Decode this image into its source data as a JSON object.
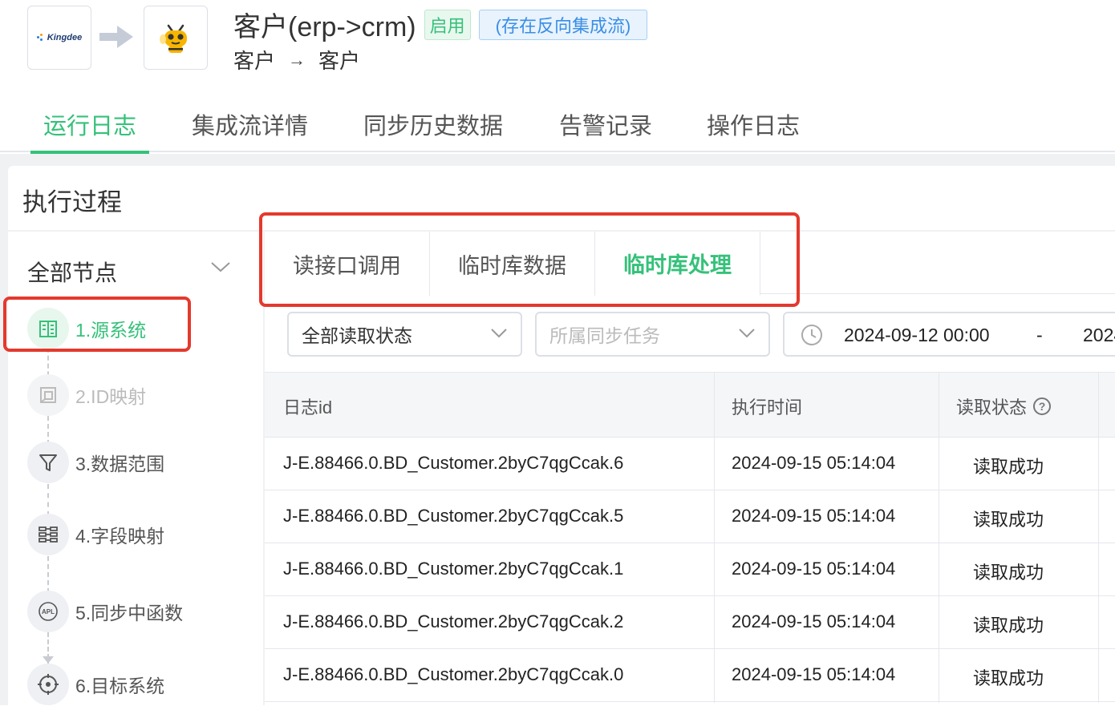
{
  "header": {
    "source_logo_text": "Kingdee",
    "title": "客户(erp->crm)",
    "status_tag": "启用",
    "reverse_tag": "(存在反向集成流)",
    "subtitle_source": "客户",
    "subtitle_arrow": "→",
    "subtitle_target": "客户"
  },
  "tabs": [
    {
      "label": "运行日志",
      "active": true
    },
    {
      "label": "集成流详情",
      "active": false
    },
    {
      "label": "同步历史数据",
      "active": false
    },
    {
      "label": "告警记录",
      "active": false
    },
    {
      "label": "操作日志",
      "active": false
    }
  ],
  "section": {
    "title": "执行过程"
  },
  "sidebar": {
    "all_nodes_label": "全部节点",
    "nodes": [
      {
        "label": "1.源系统",
        "icon": "building-icon",
        "state": "active"
      },
      {
        "label": "2.ID映射",
        "icon": "id-mapping-icon",
        "state": "disabled"
      },
      {
        "label": "3.数据范围",
        "icon": "filter-icon",
        "state": "normal"
      },
      {
        "label": "4.字段映射",
        "icon": "field-mapping-icon",
        "state": "normal"
      },
      {
        "label": "5.同步中函数",
        "icon": "apl-icon",
        "state": "normal"
      },
      {
        "label": "6.目标系统",
        "icon": "target-icon",
        "state": "normal"
      }
    ]
  },
  "subtabs": [
    {
      "label": "读接口调用",
      "active": false
    },
    {
      "label": "临时库数据",
      "active": false
    },
    {
      "label": "临时库处理",
      "active": true
    }
  ],
  "filters": {
    "read_status": "全部读取状态",
    "sync_task_placeholder": "所属同步任务",
    "date_start": "2024-09-12 00:00",
    "date_separator": "-",
    "date_end": "2024"
  },
  "table": {
    "columns": [
      "日志id",
      "执行时间",
      "读取状态"
    ],
    "rows": [
      [
        "J-E.88466.0.BD_Customer.2byC7qgCcak.6",
        "2024-09-15 05:14:04",
        "读取成功"
      ],
      [
        "J-E.88466.0.BD_Customer.2byC7qgCcak.5",
        "2024-09-15 05:14:04",
        "读取成功"
      ],
      [
        "J-E.88466.0.BD_Customer.2byC7qgCcak.1",
        "2024-09-15 05:14:04",
        "读取成功"
      ],
      [
        "J-E.88466.0.BD_Customer.2byC7qgCcak.2",
        "2024-09-15 05:14:04",
        "读取成功"
      ],
      [
        "J-E.88466.0.BD_Customer.2byC7qgCcak.0",
        "2024-09-15 05:14:04",
        "读取成功"
      ]
    ]
  },
  "colors": {
    "accent": "#35c17a",
    "highlight": "#e4392d",
    "info": "#3a8ee6"
  }
}
